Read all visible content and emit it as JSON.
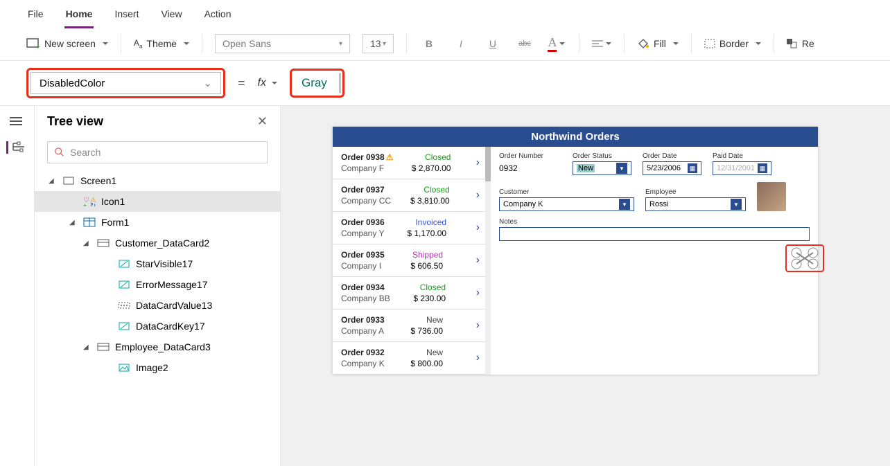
{
  "menu": {
    "file": "File",
    "home": "Home",
    "insert": "Insert",
    "view": "View",
    "action": "Action"
  },
  "ribbon": {
    "new_screen": "New screen",
    "theme": "Theme",
    "font": "Open Sans",
    "size": "13",
    "bold": "B",
    "italic": "I",
    "underline": "U",
    "strike": "abc",
    "fill": "Fill",
    "border": "Border",
    "reorder": "Re"
  },
  "formula": {
    "property": "DisabledColor",
    "value": "Gray"
  },
  "tree": {
    "title": "Tree view",
    "search_placeholder": "Search",
    "items": [
      {
        "label": "Screen1",
        "icon": "screen"
      },
      {
        "label": "Icon1",
        "icon": "icon"
      },
      {
        "label": "Form1",
        "icon": "form"
      },
      {
        "label": "Customer_DataCard2",
        "icon": "card"
      },
      {
        "label": "StarVisible17",
        "icon": "label"
      },
      {
        "label": "ErrorMessage17",
        "icon": "label"
      },
      {
        "label": "DataCardValue13",
        "icon": "input"
      },
      {
        "label": "DataCardKey17",
        "icon": "label"
      },
      {
        "label": "Employee_DataCard3",
        "icon": "card"
      },
      {
        "label": "Image2",
        "icon": "image"
      }
    ]
  },
  "app": {
    "title": "Northwind Orders",
    "orders": [
      {
        "num": "Order 0938",
        "company": "Company F",
        "status": "Closed",
        "status_class": "closed",
        "amount": "$ 2,870.00",
        "warn": true
      },
      {
        "num": "Order 0937",
        "company": "Company CC",
        "status": "Closed",
        "status_class": "closed",
        "amount": "$ 3,810.00"
      },
      {
        "num": "Order 0936",
        "company": "Company Y",
        "status": "Invoiced",
        "status_class": "invoiced",
        "amount": "$ 1,170.00"
      },
      {
        "num": "Order 0935",
        "company": "Company I",
        "status": "Shipped",
        "status_class": "shipped",
        "amount": "$ 606.50"
      },
      {
        "num": "Order 0934",
        "company": "Company BB",
        "status": "Closed",
        "status_class": "closed",
        "amount": "$ 230.00"
      },
      {
        "num": "Order 0933",
        "company": "Company A",
        "status": "New",
        "status_class": "new",
        "amount": "$ 736.00"
      },
      {
        "num": "Order 0932",
        "company": "Company K",
        "status": "New",
        "status_class": "new",
        "amount": "$ 800.00"
      }
    ],
    "detail": {
      "order_number_label": "Order Number",
      "order_number": "0932",
      "order_status_label": "Order Status",
      "order_status": "New",
      "order_date_label": "Order Date",
      "order_date": "5/23/2006",
      "paid_date_label": "Paid Date",
      "paid_date": "12/31/2001",
      "customer_label": "Customer",
      "customer": "Company K",
      "employee_label": "Employee",
      "employee": "Rossi",
      "notes_label": "Notes"
    }
  }
}
